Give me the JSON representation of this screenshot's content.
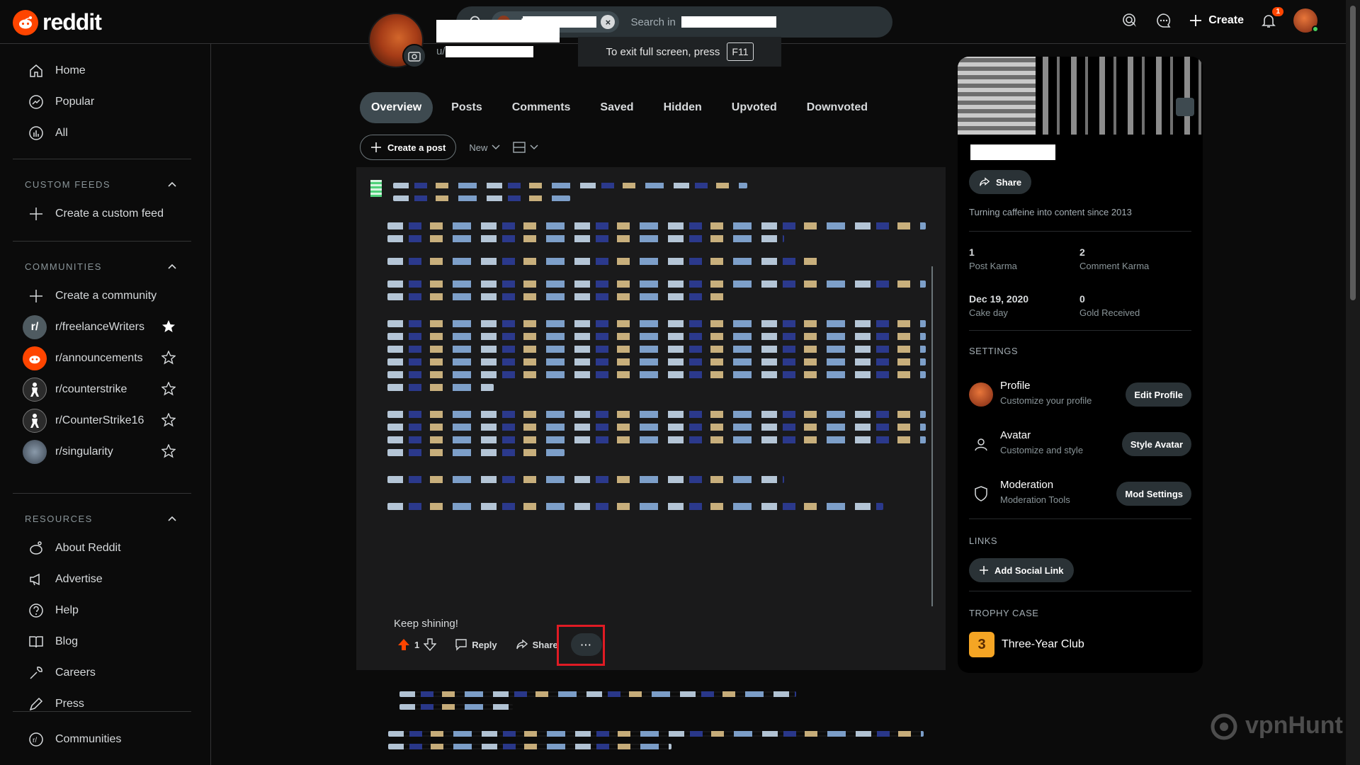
{
  "header": {
    "logo_text": "reddit",
    "search_chip_prefix": "u/",
    "search_placeholder": "Search in",
    "create_label": "Create",
    "notif_count": "1"
  },
  "toast": {
    "text": "To exit full screen, press",
    "key": "F11"
  },
  "sidebar": {
    "nav": [
      {
        "label": "Home",
        "icon": "home-icon"
      },
      {
        "label": "Popular",
        "icon": "popular-icon"
      },
      {
        "label": "All",
        "icon": "all-icon"
      }
    ],
    "custom_feeds_title": "CUSTOM FEEDS",
    "create_custom_feed": "Create a custom feed",
    "communities_title": "COMMUNITIES",
    "create_community": "Create a community",
    "communities": [
      {
        "name": "r/freelanceWriters",
        "avatar_color": "#4f5b61",
        "favorite": true
      },
      {
        "name": "r/announcements",
        "avatar_color": "#ff4500",
        "favorite": false
      },
      {
        "name": "r/counterstrike",
        "avatar_color": "#2b2b2b",
        "favorite": false
      },
      {
        "name": "r/CounterStrike16",
        "avatar_color": "#2b2b2b",
        "favorite": false
      },
      {
        "name": "r/singularity",
        "avatar_color": "#5a6a7a",
        "favorite": false
      }
    ],
    "resources_title": "RESOURCES",
    "resources": [
      {
        "label": "About Reddit",
        "icon": "about-icon"
      },
      {
        "label": "Advertise",
        "icon": "megaphone-icon"
      },
      {
        "label": "Help",
        "icon": "help-icon"
      },
      {
        "label": "Blog",
        "icon": "book-icon"
      },
      {
        "label": "Careers",
        "icon": "wrench-icon"
      },
      {
        "label": "Press",
        "icon": "pen-icon"
      }
    ],
    "communities_link": "Communities"
  },
  "profile": {
    "handle_prefix": "u/",
    "tabs": [
      "Overview",
      "Posts",
      "Comments",
      "Saved",
      "Hidden",
      "Upvoted",
      "Downvoted"
    ],
    "active_tab": "Overview",
    "create_post": "Create a post",
    "sort": "New"
  },
  "comment": {
    "text": "Keep shining!",
    "votes": "1",
    "reply": "Reply",
    "share": "Share",
    "more": "···"
  },
  "right": {
    "share": "Share",
    "bio": "Turning caffeine into content since 2013",
    "stats": [
      {
        "value": "1",
        "label": "Post Karma"
      },
      {
        "value": "2",
        "label": "Comment Karma"
      },
      {
        "value": "Dec 19, 2020",
        "label": "Cake day"
      },
      {
        "value": "0",
        "label": "Gold Received"
      }
    ],
    "settings_title": "SETTINGS",
    "settings": [
      {
        "title": "Profile",
        "sub": "Customize your profile",
        "button": "Edit Profile"
      },
      {
        "title": "Avatar",
        "sub": "Customize and style",
        "button": "Style Avatar"
      },
      {
        "title": "Moderation",
        "sub": "Moderation Tools",
        "button": "Mod Settings"
      }
    ],
    "links_title": "LINKS",
    "add_link": "Add Social Link",
    "trophy_title": "TROPHY CASE",
    "trophy": "Three-Year Club"
  },
  "watermark": "vpnHunt"
}
